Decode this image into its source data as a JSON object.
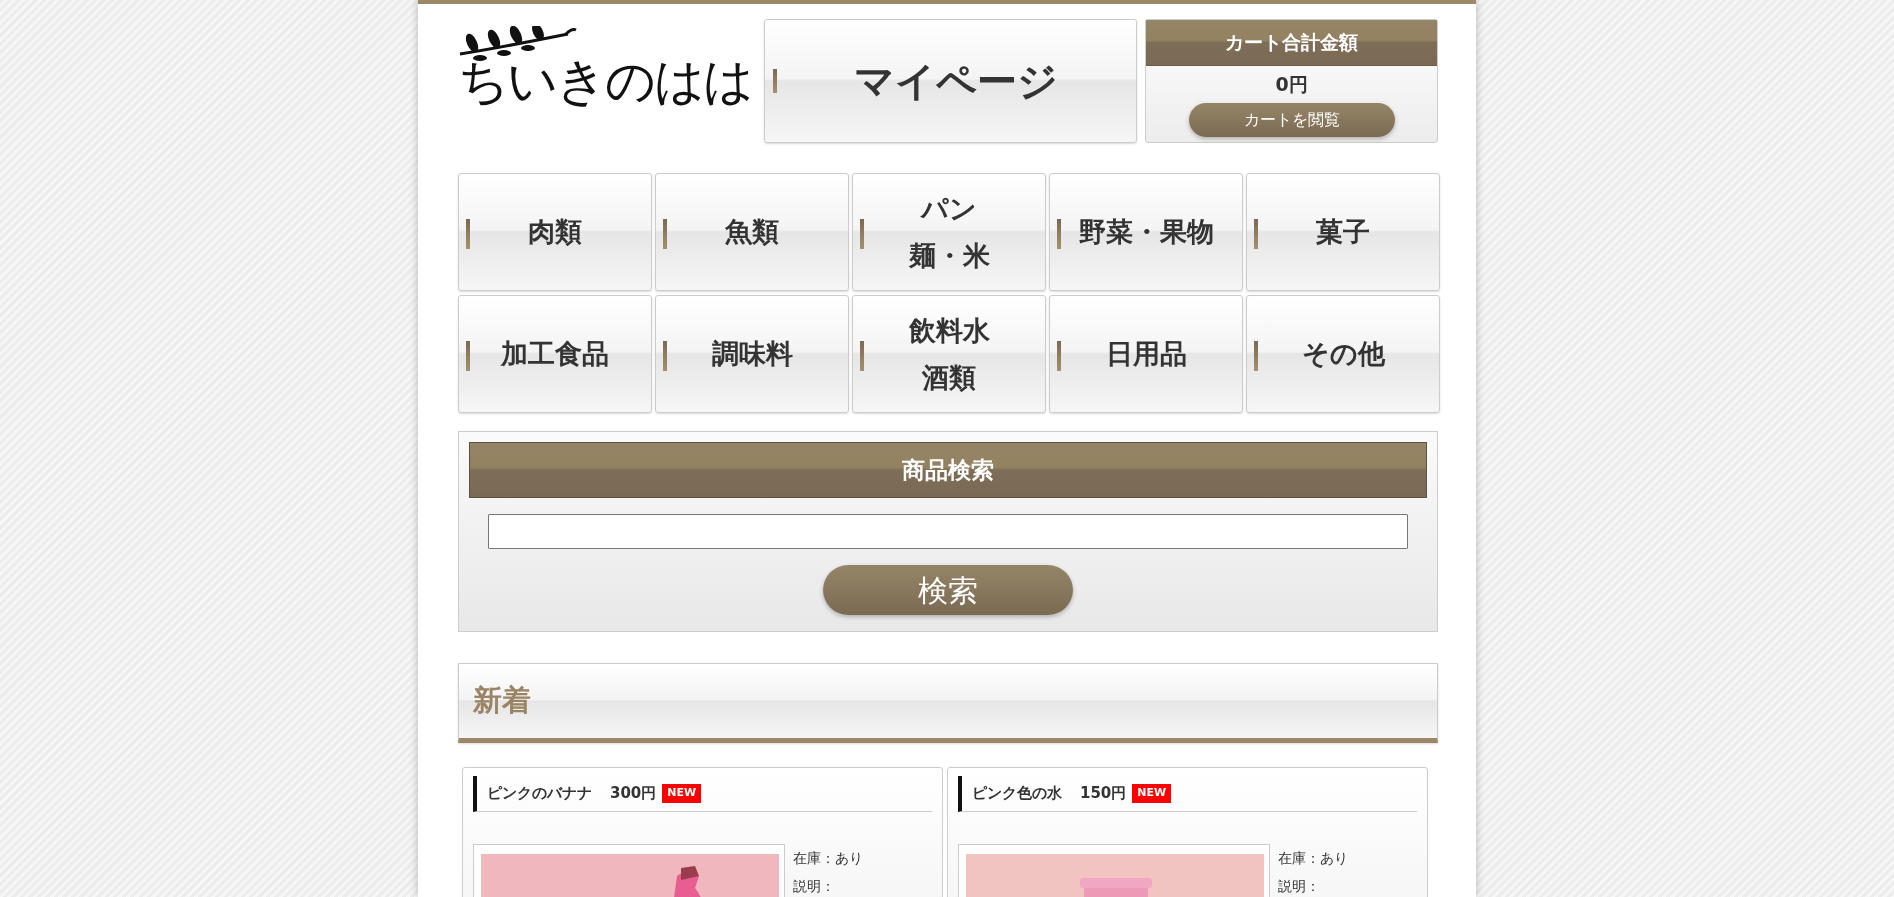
{
  "logo": {
    "text": "ちいきのはは"
  },
  "mypage": {
    "label": "マイページ"
  },
  "cart": {
    "title": "カート合計金額",
    "total": "0円",
    "button": "カートを閲覧"
  },
  "categories": [
    {
      "lines": [
        "肉類"
      ]
    },
    {
      "lines": [
        "魚類"
      ]
    },
    {
      "lines": [
        "パン",
        "麺・米"
      ]
    },
    {
      "lines": [
        "野菜・果物"
      ]
    },
    {
      "lines": [
        "菓子"
      ]
    },
    {
      "lines": [
        "加工食品"
      ]
    },
    {
      "lines": [
        "調味料"
      ]
    },
    {
      "lines": [
        "飲料水",
        "酒類"
      ]
    },
    {
      "lines": [
        "日用品"
      ]
    },
    {
      "lines": [
        "その他"
      ]
    }
  ],
  "search": {
    "title": "商品検索",
    "button": "検索"
  },
  "new_section": {
    "title": "新着"
  },
  "products": [
    {
      "name": "ピンクのバナナ",
      "price": "300円",
      "badge": "NEW",
      "stock": "在庫：あり",
      "description": "説明："
    },
    {
      "name": "ピンク色の水",
      "price": "150円",
      "badge": "NEW",
      "stock": "在庫：あり",
      "description": "説明："
    }
  ]
}
